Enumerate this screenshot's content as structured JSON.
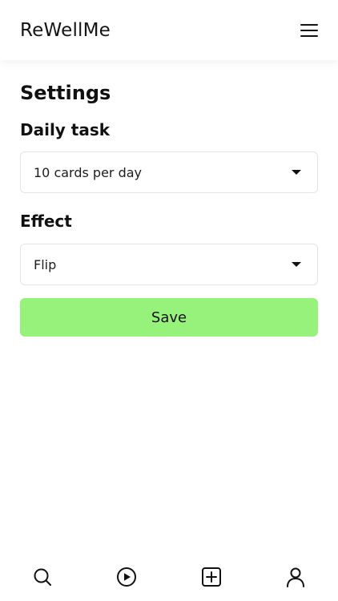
{
  "header": {
    "brand": "ReWellMe",
    "menu_icon": "hamburger-menu-icon"
  },
  "settings": {
    "title": "Settings",
    "daily_task": {
      "label": "Daily task",
      "selected": "10 cards per day"
    },
    "effect": {
      "label": "Effect",
      "selected": "Flip"
    },
    "save_label": "Save"
  },
  "bottom_nav": {
    "items": [
      {
        "icon": "search-icon"
      },
      {
        "icon": "play-circle-icon"
      },
      {
        "icon": "add-square-icon"
      },
      {
        "icon": "user-icon"
      }
    ]
  },
  "colors": {
    "accent": "#97f27b",
    "text": "#111111",
    "border": "#e4e4e4"
  }
}
